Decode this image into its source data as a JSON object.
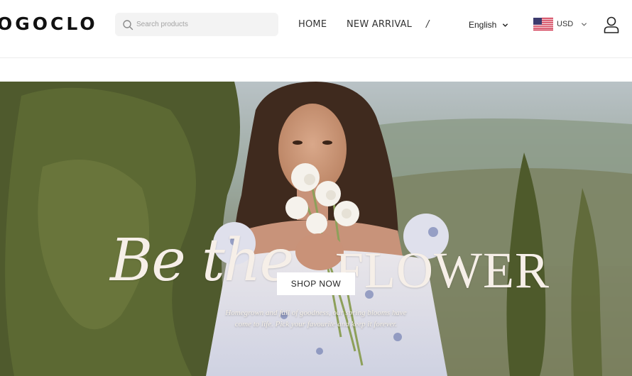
{
  "brand": {
    "logo_text": "OGOCLO"
  },
  "search": {
    "placeholder": "Search products"
  },
  "nav": {
    "items": [
      "HOME",
      "NEW ARRIVAL",
      "/"
    ]
  },
  "locale": {
    "language": "English",
    "currency": "USD"
  },
  "icons": {
    "search": "search-icon",
    "language_dropdown": "chevron-down-icon",
    "currency_flag": "us-flag-icon",
    "currency_dropdown": "chevron-down-icon",
    "account": "user-icon"
  },
  "hero": {
    "script_text": "Be the",
    "caps_text": "FLOWER",
    "cta_label": "SHOP NOW",
    "tagline_line1": "Homegrown and full of goodness, our spring blooms have",
    "tagline_line2": "come to life. Pick your favourite and keep it forever."
  },
  "colors": {
    "header_bg": "#ffffff",
    "search_bg": "#f3f3f3",
    "hero_text": "#f6efe8",
    "cta_bg": "#ffffff"
  }
}
